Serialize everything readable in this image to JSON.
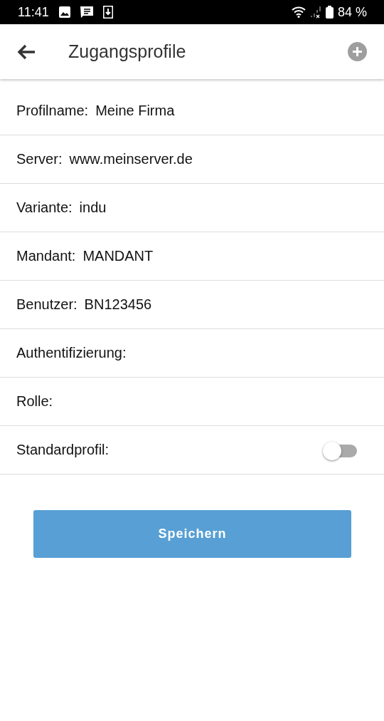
{
  "status_bar": {
    "time": "11:41",
    "battery": "84 %"
  },
  "app_bar": {
    "title": "Zugangsprofile"
  },
  "fields": [
    {
      "kind": "text",
      "label": "Profilname:",
      "value": "Meine Firma"
    },
    {
      "kind": "text",
      "label": "Server:",
      "value": "www.meinserver.de"
    },
    {
      "kind": "text",
      "label": "Variante:",
      "value": "indu"
    },
    {
      "kind": "text",
      "label": "Mandant:",
      "value": "MANDANT"
    },
    {
      "kind": "text",
      "label": "Benutzer:",
      "value": "BN123456"
    },
    {
      "kind": "text",
      "label": "Authentifizierung:"
    },
    {
      "kind": "text",
      "label": "Rolle:"
    },
    {
      "kind": "switch",
      "label": "Standardprofil:",
      "on": false
    }
  ],
  "save_button": {
    "label": "Speichern"
  }
}
